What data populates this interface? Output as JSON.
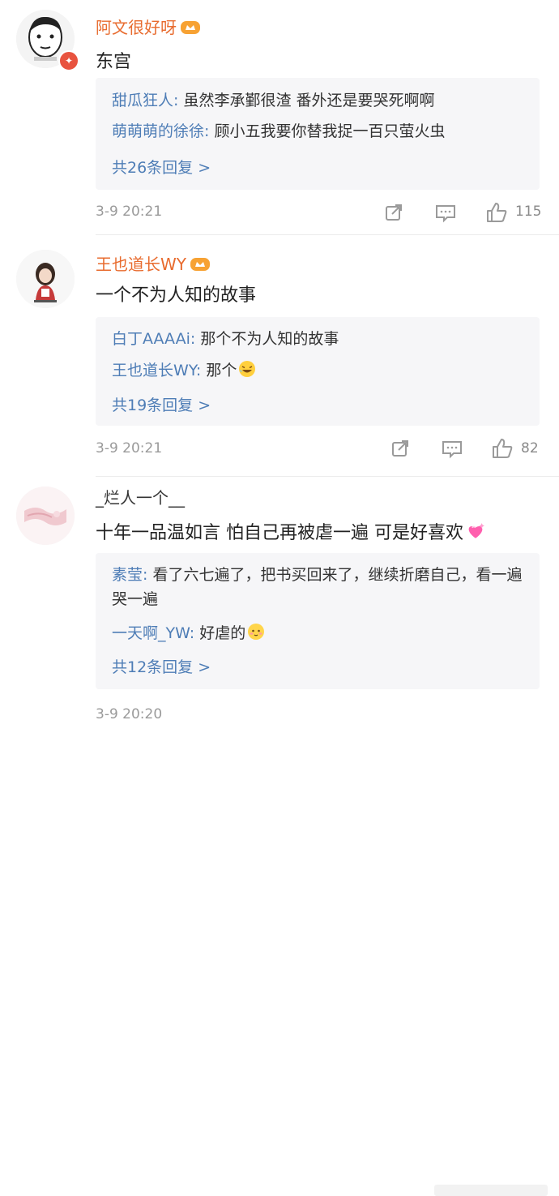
{
  "comments": [
    {
      "username": "阿文很好呀",
      "content": "东宫",
      "replies": [
        {
          "name": "甜瓜狂人",
          "sep": ": ",
          "text": "虽然李承鄞很渣 番外还是要哭死啊啊"
        },
        {
          "name": "萌萌萌的徐徐",
          "sep": ": ",
          "text": "顾小五我要你替我捉一百只萤火虫"
        }
      ],
      "more": "共26条回复 >",
      "time": "3-9 20:21",
      "likes": "115"
    },
    {
      "username": "王也道长WY",
      "content": "一个不为人知的故事",
      "replies": [
        {
          "name": "白丁AAAAi",
          "sep": ": ",
          "text": "那个不为人知的故事"
        },
        {
          "name": "王也道长WY",
          "sep": ": ",
          "text": "那个"
        }
      ],
      "more": "共19条回复 >",
      "time": "3-9 20:21",
      "likes": "82"
    },
    {
      "username": "_烂人一个__",
      "content": "十年一品温如言 怕自己再被虐一遍 可是好喜欢",
      "replies": [
        {
          "name": "素莹",
          "sep": ": ",
          "text": "看了六七遍了，把书买回来了，继续折磨自己，看一遍哭一遍"
        },
        {
          "name": "一天啊_YW",
          "sep": ": ",
          "text": "好虐的"
        }
      ],
      "more": "共12条回复 >",
      "time": "3-9 20:20"
    }
  ],
  "icons": {
    "repost": "repost-icon",
    "comment": "comment-icon",
    "like": "thumbs-up-icon",
    "vip": "vip-crown-icon",
    "laugh": "laughing-emoji-icon",
    "heart": "sparkling-heart-emoji-icon",
    "shy": "blushing-emoji-icon"
  },
  "colors": {
    "username": "#e86b2e",
    "reply_name": "#4e7db6",
    "meta": "#9a9a9a",
    "reply_bg": "#f6f6f8"
  }
}
